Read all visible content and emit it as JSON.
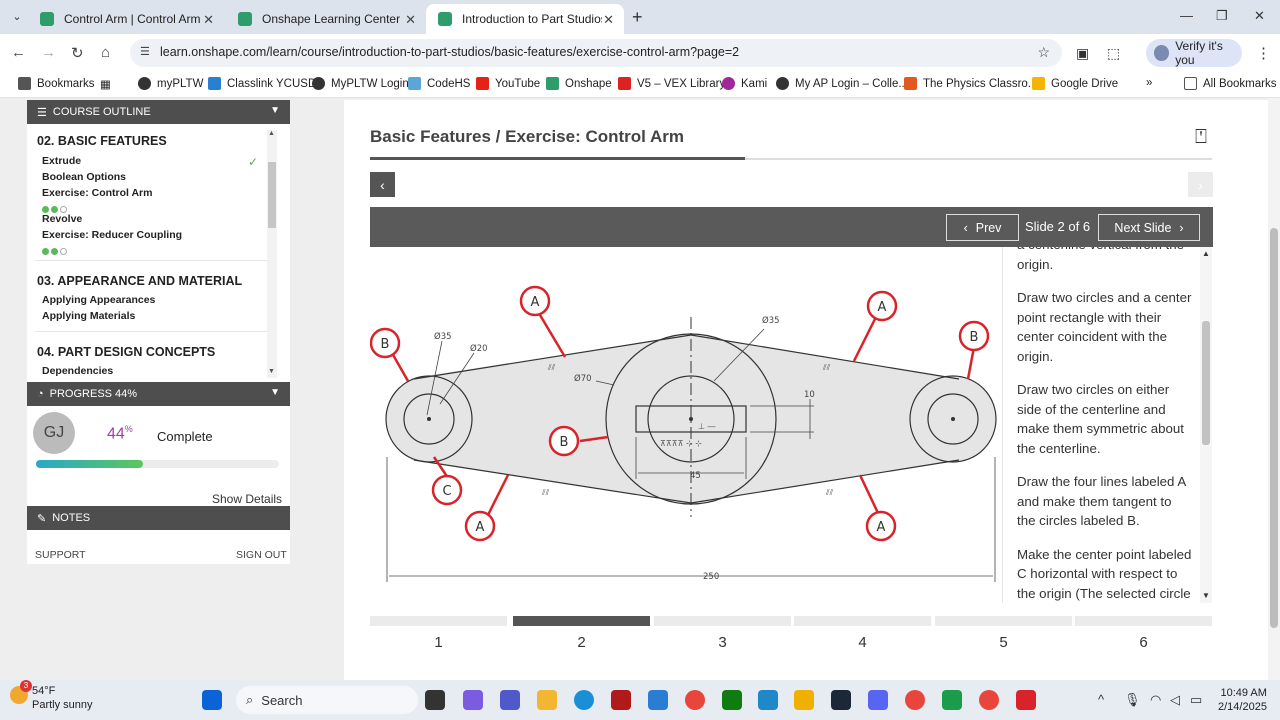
{
  "browser": {
    "tabs": [
      {
        "title": "Control Arm | Control Arm",
        "active": false
      },
      {
        "title": "Onshape Learning Center",
        "active": false
      },
      {
        "title": "Introduction to Part Studios - E",
        "active": true
      }
    ],
    "url": "learn.onshape.com/learn/course/introduction-to-part-studios/basic-features/exercise-control-arm?page=2",
    "profile_label": "Verify it's you",
    "bookmarks": [
      "Bookmarks",
      "myPLTW",
      "Classlink YCUSD",
      "MyPLTW Login",
      "CodeHS",
      "YouTube",
      "Onshape",
      "V5 – VEX Library",
      "Kami",
      "My AP Login – Colle...",
      "The Physics Classro...",
      "Google Drive"
    ],
    "all_bookmarks": "All Bookmarks"
  },
  "sidebar": {
    "outline_title": "COURSE OUTLINE",
    "sections": [
      {
        "title": "02. BASIC FEATURES",
        "items": [
          "Extrude",
          "Boolean Options",
          "Exercise: Control Arm",
          "Revolve",
          "Exercise: Reducer Coupling"
        ]
      },
      {
        "title": "03. APPEARANCE AND MATERIAL",
        "items": [
          "Applying Appearances",
          "Applying Materials"
        ]
      },
      {
        "title": "04. PART DESIGN CONCEPTS",
        "items": [
          "Dependencies"
        ]
      }
    ],
    "progress_title": "PROGRESS 44%",
    "initials": "GJ",
    "percent": "44",
    "percent_sign": "%",
    "progress_value": 0.44,
    "complete_label": "Complete",
    "show_details": "Show Details",
    "notes_title": "NOTES",
    "support": "SUPPORT",
    "sign_out": "SIGN OUT"
  },
  "main": {
    "breadcrumb": "Basic Features / Exercise: Control Arm",
    "prev": "Prev",
    "next": "Next Slide",
    "slide_count": "Slide 2 of 6",
    "instructions": [
      "a centerline vertical from the origin.",
      "Draw two circles and a center point rectangle with their center coincident with the origin.",
      "Draw two circles on either side of the centerline and make them symmetric about the centerline.",
      "Draw the four lines labeled A and make them tangent to the circles labeled B.",
      "Make the center point labeled C horizontal with respect to the origin (The selected circle will follow.)"
    ],
    "slide_tabs": [
      "1",
      "2",
      "3",
      "4",
      "5",
      "6"
    ],
    "active_slide": 2
  },
  "drawing": {
    "callouts": [
      "A",
      "A",
      "A",
      "A",
      "B",
      "B",
      "B",
      "C"
    ],
    "dims": [
      "Ø35",
      "Ø20",
      "Ø70",
      "Ø35",
      "10",
      "45",
      "250"
    ]
  },
  "taskbar": {
    "temp": "54°F",
    "condition": "Partly sunny",
    "badge": "3",
    "search": "Search",
    "time": "10:49 AM",
    "date": "2/14/2025"
  }
}
